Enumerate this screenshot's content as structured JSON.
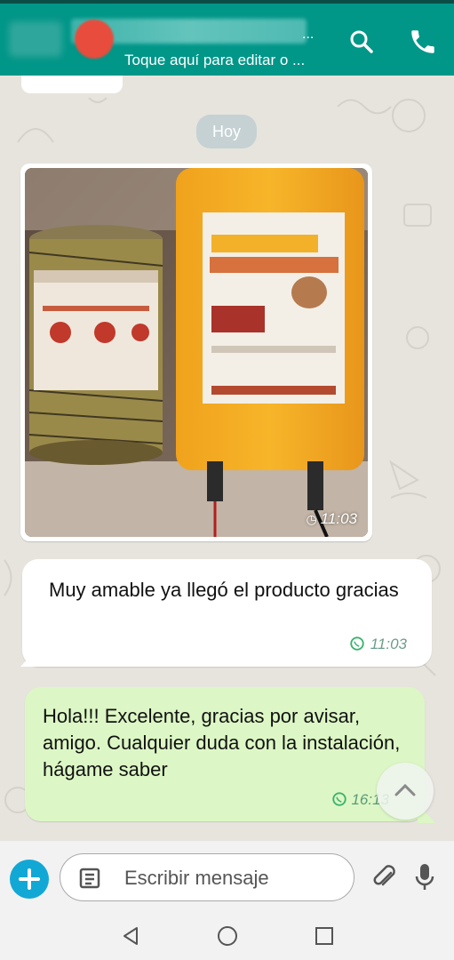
{
  "header": {
    "subtitle": "Toque aquí para editar o ...",
    "more_dots": "...",
    "search_icon": "search-icon",
    "call_icon": "phone-icon",
    "color": "#009688"
  },
  "day_label": "Hoy",
  "messages": [
    {
      "type": "image",
      "time": "11:03"
    },
    {
      "type": "incoming",
      "text": "Muy amable ya llegó el producto gracias",
      "time": "11:03"
    },
    {
      "type": "outgoing",
      "text": "Hola!!! Excelente, gracias por avisar, amigo. Cualquier duda con la instalación, hágame saber",
      "time": "16:13"
    }
  ],
  "input": {
    "placeholder": "Escribir mensaje",
    "plus_icon": "plus-icon",
    "attach_icon": "paperclip-icon",
    "mic_icon": "microphone-icon"
  },
  "navbar": [
    "back-icon",
    "home-icon",
    "recents-icon"
  ],
  "colors": {
    "incoming_bubble": "#ffffff",
    "outgoing_bubble": "#dcf7c5",
    "accent_plus": "#12a8d5"
  }
}
